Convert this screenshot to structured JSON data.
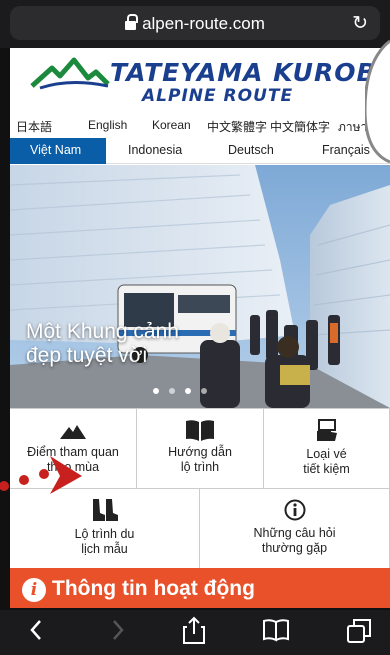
{
  "browser": {
    "url": "alpen-route.com",
    "reload_icon": "↻"
  },
  "logo": {
    "line1": "TATEYAMA KUROBE",
    "line2": "ALPINE ROUTE"
  },
  "languages_row1": [
    "日本語",
    "English",
    "Korean",
    "中文繁體字",
    "中文簡体字",
    "ภาษาไทย"
  ],
  "languages_row2": [
    "Việt Nam",
    "Indonesia",
    "Deutsch",
    "Français"
  ],
  "active_language": "Việt Nam",
  "hero": {
    "caption_line1": "Một Khung cảnh",
    "caption_line2": "đẹp tuyệt vời",
    "slides": 4,
    "active_slide": 3
  },
  "menu": {
    "seasonal": {
      "line1": "Điểm tham quan",
      "line2": "theo mùa",
      "icon": "mountain-icon"
    },
    "route_guide": {
      "line1": "Hướng dẫn",
      "line2": "lộ trình",
      "icon": "book-icon"
    },
    "tickets": {
      "line1": "Loại vé",
      "line2": "tiết kiệm",
      "icon": "ticket-hand-icon"
    },
    "sample_itinerary": {
      "line1": "Lộ trình du",
      "line2": "lịch mẫu",
      "icon": "boots-icon"
    },
    "faq": {
      "line1": "Những câu hỏi",
      "line2": "thường gặp",
      "icon": "info-icon"
    }
  },
  "banner": {
    "text": "Thông tin hoạt động",
    "icon": "i"
  },
  "toolbar": [
    "back-icon",
    "forward-icon",
    "share-icon",
    "bookmarks-icon",
    "tabs-icon"
  ],
  "colors": {
    "brand_blue": "#1b3f8f",
    "lang_active": "#0a5ea8",
    "banner": "#e8512a",
    "arrow_red": "#c8201e"
  }
}
